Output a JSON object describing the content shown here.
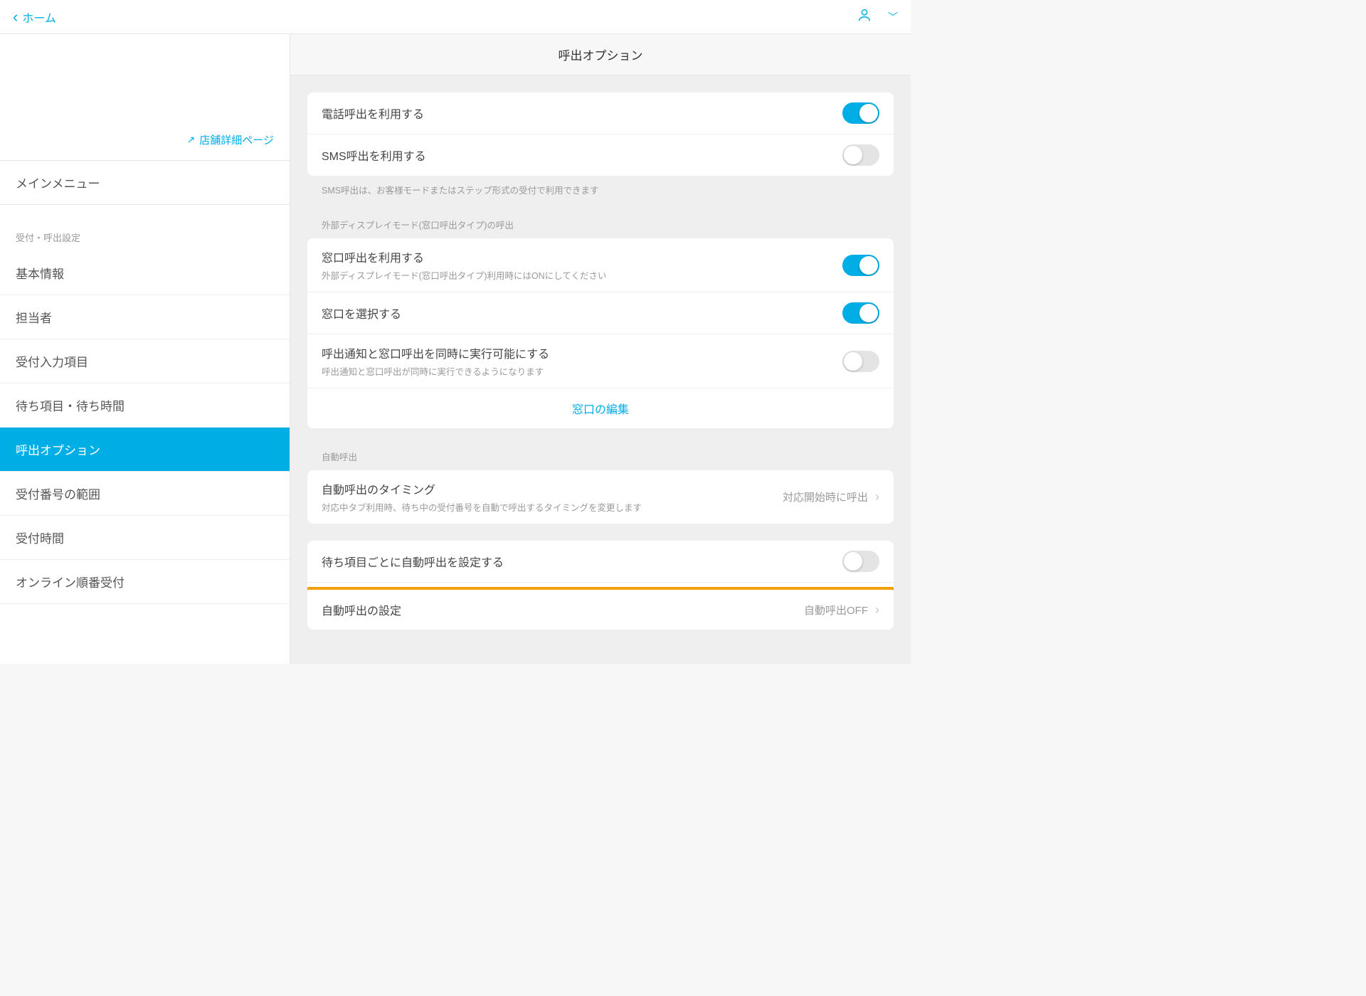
{
  "topbar": {
    "back_label": "ホーム"
  },
  "sidebar": {
    "store_link": "店舗詳細ページ",
    "main_menu": "メインメニュー",
    "section_header": "受付・呼出設定",
    "items": [
      {
        "label": "基本情報"
      },
      {
        "label": "担当者"
      },
      {
        "label": "受付入力項目"
      },
      {
        "label": "待ち項目・待ち時間"
      },
      {
        "label": "呼出オプション"
      },
      {
        "label": "受付番号の範囲"
      },
      {
        "label": "受付時間"
      },
      {
        "label": "オンライン順番受付"
      }
    ]
  },
  "main": {
    "title": "呼出オプション",
    "group1": {
      "phone": {
        "title": "電話呼出を利用する",
        "on": true
      },
      "sms": {
        "title": "SMS呼出を利用する",
        "on": false
      },
      "sms_note": "SMS呼出は、お客様モードまたはステップ形式の受付で利用できます"
    },
    "group2_label": "外部ディスプレイモード(窓口呼出タイプ)の呼出",
    "group2": {
      "window_call": {
        "title": "窓口呼出を利用する",
        "sub": "外部ディスプレイモード(窓口呼出タイプ)利用時にはONにしてください",
        "on": true
      },
      "window_select": {
        "title": "窓口を選択する",
        "on": true
      },
      "simultaneous": {
        "title": "呼出通知と窓口呼出を同時に実行可能にする",
        "sub": "呼出通知と窓口呼出が同時に実行できるようになります",
        "on": false
      },
      "edit_link": "窓口の編集"
    },
    "group3_label": "自動呼出",
    "group3": {
      "timing": {
        "title": "自動呼出のタイミング",
        "sub": "対応中タブ利用時、待ち中の受付番号を自動で呼出するタイミングを変更します",
        "value": "対応開始時に呼出"
      }
    },
    "group4": {
      "per_item": {
        "title": "待ち項目ごとに自動呼出を設定する",
        "on": false
      },
      "auto_setting": {
        "title": "自動呼出の設定",
        "value": "自動呼出OFF"
      }
    }
  }
}
